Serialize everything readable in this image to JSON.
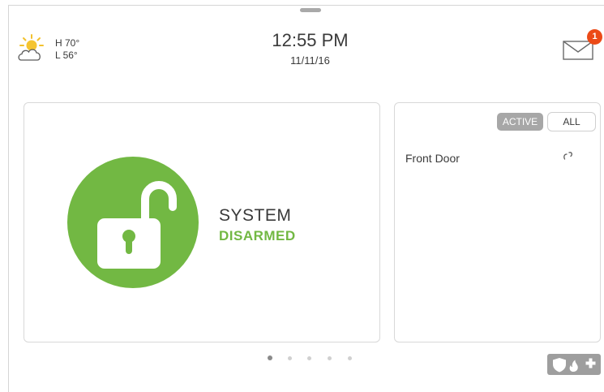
{
  "weather": {
    "high": "H 70°",
    "low": "L 56°",
    "icon": "partly-sunny-icon"
  },
  "clock": {
    "time": "12:55 PM",
    "date": "11/11/16"
  },
  "messages": {
    "icon": "envelope-icon",
    "badge_count": "1",
    "badge_color": "#ec4a17"
  },
  "system": {
    "line1": "SYSTEM",
    "line2": "DISARMED",
    "icon": "unlocked-padlock-icon",
    "accent_color": "#72b843"
  },
  "sensors": {
    "tabs": [
      {
        "label": "ACTIVE",
        "selected": true
      },
      {
        "label": "ALL",
        "selected": false
      }
    ],
    "items": [
      {
        "name": "Front Door",
        "icon": "door-open-icon"
      }
    ]
  },
  "pagination": {
    "total": 5,
    "current": 1
  },
  "emergency": {
    "icons": [
      "shield-icon",
      "fire-icon",
      "medical-cross-icon"
    ]
  }
}
